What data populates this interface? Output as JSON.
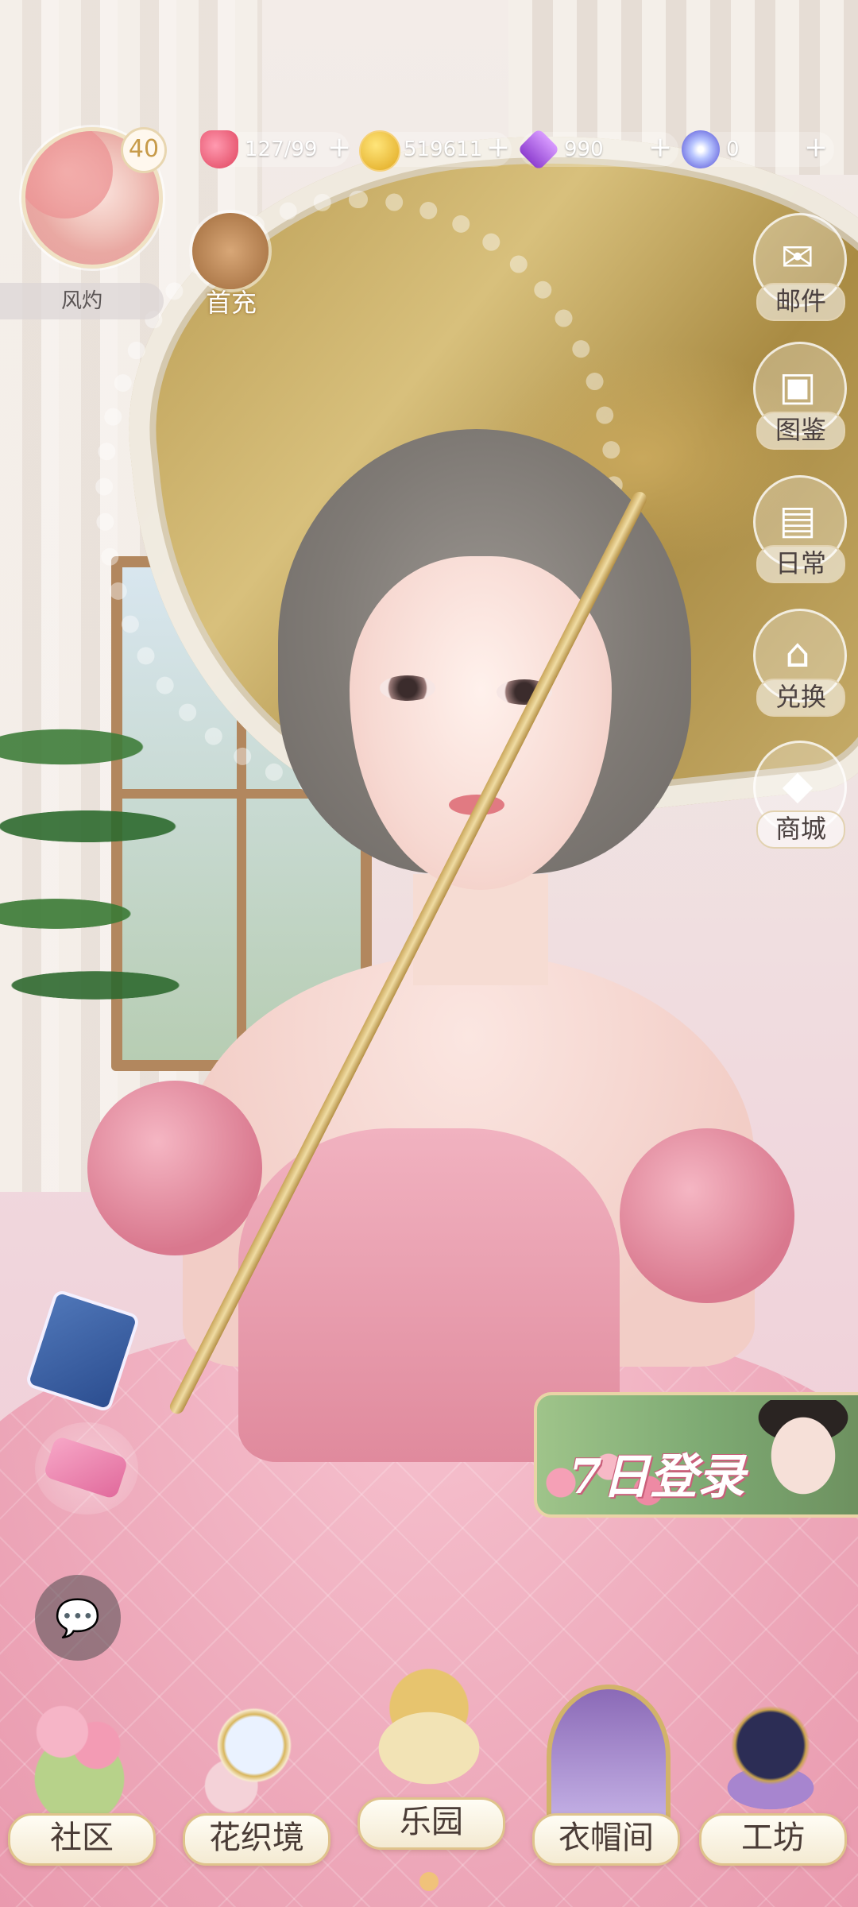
{
  "player": {
    "name": "风灼",
    "level": "40"
  },
  "resources": {
    "stamina": {
      "value": "127/99",
      "plus": "+"
    },
    "gold": {
      "value": "519611",
      "plus": "+"
    },
    "gems": {
      "value": "990",
      "plus": "+"
    },
    "stars": {
      "value": "0",
      "plus": "+"
    }
  },
  "first_charge": {
    "label": "首充"
  },
  "side_menu": [
    {
      "label": "邮件",
      "icon": "mail-icon"
    },
    {
      "label": "图鉴",
      "icon": "album-icon"
    },
    {
      "label": "日常",
      "icon": "daily-icon"
    },
    {
      "label": "兑换",
      "icon": "shop-icon"
    },
    {
      "label": "商城",
      "icon": "diamond-icon"
    }
  ],
  "login_banner": {
    "text": "7日登录"
  },
  "bottom_nav": [
    {
      "label": "社区"
    },
    {
      "label": "花织境"
    },
    {
      "label": "乐园"
    },
    {
      "label": "衣帽间"
    },
    {
      "label": "工坊"
    }
  ],
  "colors": {
    "accent_gold": "#dfc38c",
    "dress_pink": "#e896ab"
  }
}
